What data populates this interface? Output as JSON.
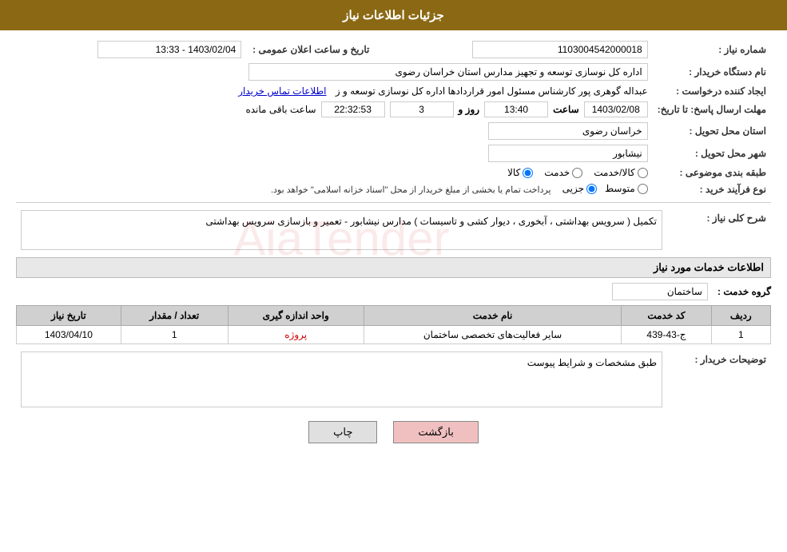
{
  "header": {
    "title": "جزئیات اطلاعات نیاز"
  },
  "fields": {
    "shomareNiaz_label": "شماره نیاز :",
    "shomareNiaz_value": "1103004542000018",
    "namDastgah_label": "نام دستگاه خریدار :",
    "namDastgah_value": "اداره کل نوسازی  توسعه و تجهیز مدارس استان خراسان رضوی",
    "ijadKonande_label": "ایجاد کننده درخواست :",
    "ijadKonande_value": "عبداله گوهری پور کارشناس مسئول امور قراردادها  اداره کل نوسازی  توسعه و ز",
    "ijadKonande_link": "اطلاعات تماس خریدار",
    "mohlatErsal_label": "مهلت ارسال پاسخ: تا تاریخ:",
    "date_value": "1403/02/08",
    "time_label": "ساعت",
    "time_value": "13:40",
    "roz_label": "روز و",
    "roz_value": "3",
    "remaining_value": "22:32:53",
    "remaining_label": "ساعت باقی مانده",
    "ostan_label": "استان محل تحویل :",
    "ostan_value": "خراسان رضوی",
    "shahr_label": "شهر محل تحویل :",
    "shahr_value": "نیشابور",
    "tabaqe_label": "طبقه بندی موضوعی :",
    "radio_kala": "کالا",
    "radio_khedmat": "خدمت",
    "radio_kala_khedmat": "کالا/خدمت",
    "noeFarayand_label": "نوع فرآیند خرید :",
    "radio_jozii": "جزیی",
    "radio_motevaset": "متوسط",
    "noeFarayand_note": "پرداخت تمام یا بخشی از مبلغ خریدار از محل \"اسناد خزانه اسلامی\" خواهد بود.",
    "tarikh_label": "تاریخ و ساعت اعلان عمومی :",
    "tarikh_value": "1403/02/04 - 13:33",
    "sharhKoli_label": "شرح کلی نیاز :",
    "sharhKoli_value": "تکمیل ( سرویس بهداشتی ، آبخوری ، دیوار کشی و تاسیسات ) مدارس نیشابور - تعمیر و بازسازی سرویس بهداشتی",
    "khadamat_label": "اطلاعات خدمات مورد نیاز",
    "groupKhadamat_label": "گروه خدمت :",
    "groupKhadamat_value": "ساختمان",
    "table": {
      "headers": [
        "ردیف",
        "کد خدمت",
        "نام خدمت",
        "واحد اندازه گیری",
        "تعداد / مقدار",
        "تاریخ نیاز"
      ],
      "rows": [
        {
          "radif": "1",
          "kodKhadamat": "ج-43-439",
          "namKhadamat": "سایر فعالیت‌های تخصصی ساختمان",
          "vahed": "پروژه",
          "tedad": "1",
          "tarikh": "1403/04/10"
        }
      ]
    },
    "toseifat_label": "توضیحات خریدار :",
    "toseifat_value": "طبق مشخصات و شرایط پیوست"
  },
  "buttons": {
    "print": "چاپ",
    "back": "بازگشت"
  }
}
